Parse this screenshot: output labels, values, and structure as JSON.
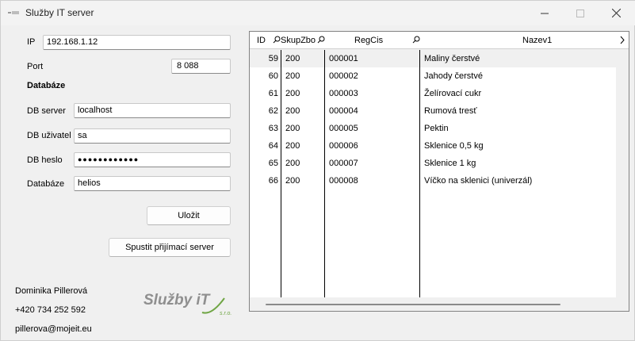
{
  "window": {
    "title": "Služby IT server"
  },
  "form": {
    "ip_label": "IP",
    "ip_value": "192.168.1.12",
    "port_label": "Port",
    "port_value": "8 088",
    "db_section": "Databáze",
    "db_server_label": "DB server",
    "db_server_value": "localhost",
    "db_user_label": "DB uživatel",
    "db_user_value": "sa",
    "db_password_label": "DB heslo",
    "db_password_value": "●●●●●●●●●●●●",
    "db_name_label": "Databáze",
    "db_name_value": "helios",
    "save_button": "Uložit",
    "start_button": "Spustit přijímací server"
  },
  "contact": {
    "name": "Dominika Pillerová",
    "phone": "+420 734 252 592",
    "email": "pillerova@mojeit.eu"
  },
  "logo": {
    "text": "Služby iT",
    "sub": "s.r.o."
  },
  "grid": {
    "columns": [
      "ID",
      "SkupZbo",
      "RegCis",
      "Nazev1"
    ],
    "rows": [
      {
        "id": "59",
        "skup": "200",
        "reg": "000001",
        "nazev": "Maliny čerstvé"
      },
      {
        "id": "60",
        "skup": "200",
        "reg": "000002",
        "nazev": "Jahody čerstvé"
      },
      {
        "id": "61",
        "skup": "200",
        "reg": "000003",
        "nazev": "Želírovací cukr"
      },
      {
        "id": "62",
        "skup": "200",
        "reg": "000004",
        "nazev": "Rumová tresť"
      },
      {
        "id": "63",
        "skup": "200",
        "reg": "000005",
        "nazev": "Pektin"
      },
      {
        "id": "64",
        "skup": "200",
        "reg": "000006",
        "nazev": "Sklenice 0,5 kg"
      },
      {
        "id": "65",
        "skup": "200",
        "reg": "000007",
        "nazev": "Sklenice 1 kg"
      },
      {
        "id": "66",
        "skup": "200",
        "reg": "000008",
        "nazev": "Víčko na sklenici (univerzál)"
      }
    ]
  },
  "colors": {
    "logo_grey": "#8f8f8f",
    "logo_green": "#6fa544"
  }
}
